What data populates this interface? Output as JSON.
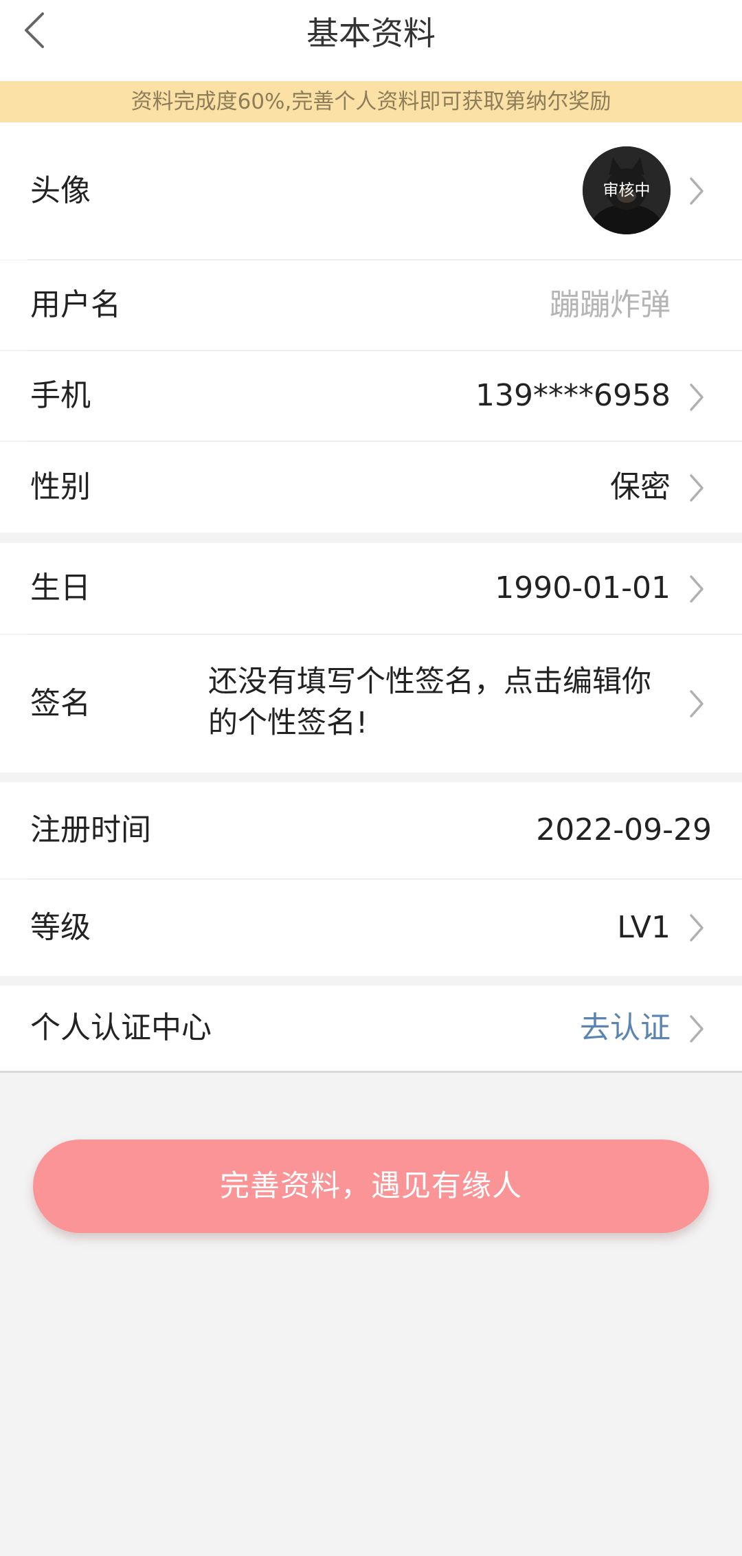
{
  "meta": {
    "domain": "Computer-Use"
  },
  "header": {
    "title": "基本资料"
  },
  "banner": {
    "text": "资料完成度60%,完善个人资料即可获取第纳尔奖励",
    "background": "#fbe1a6",
    "text_color": "#8e7d59"
  },
  "rows": {
    "avatar": {
      "label": "头像",
      "status_overlay": "审核中"
    },
    "username": {
      "label": "用户名",
      "value": "蹦蹦炸弹"
    },
    "phone": {
      "label": "手机",
      "value": "139****6958"
    },
    "gender": {
      "label": "性别",
      "value": "保密"
    },
    "birthday": {
      "label": "生日",
      "value": "1990-01-01"
    },
    "signature": {
      "label": "签名",
      "value": "还没有填写个性签名，点击编辑你的个性签名!"
    },
    "register_time": {
      "label": "注册时间",
      "value": "2022-09-29"
    },
    "level": {
      "label": "等级",
      "value": "LV1"
    },
    "certification": {
      "label": "个人认证中心",
      "value": "去认证"
    }
  },
  "cta": {
    "label": "完善资料，遇见有缘人",
    "color": "#fb9496"
  },
  "icons": {
    "back": "back-arrow-icon",
    "chevron": "chevron-right-icon"
  },
  "colors": {
    "page_background": "#f3f3f3",
    "link": "#5b84b1",
    "placeholder": "#b5b5b5"
  }
}
